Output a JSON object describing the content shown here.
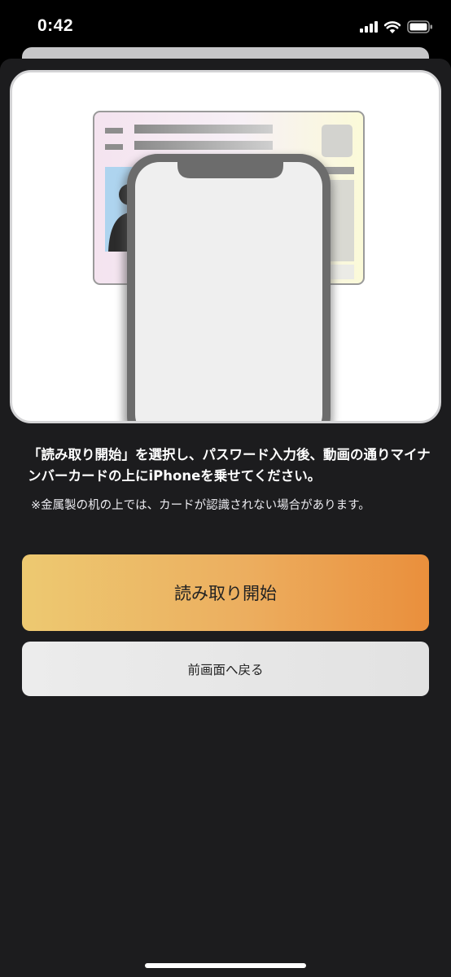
{
  "status_bar": {
    "time": "0:42",
    "icons": [
      "signal-icon",
      "wifi-icon",
      "battery-icon"
    ]
  },
  "instruction": {
    "main_text": "「読み取り開始」を選択し、パスワード入力後、動画の通りマイナンバーカードの上にiPhoneを乗せてください。",
    "note_text": "※金属製の机の上では、カードが認識されない場合があります。"
  },
  "buttons": {
    "start_read_label": "読み取り開始",
    "back_label": "前画面へ戻る"
  },
  "colors": {
    "sheet_background": "#1c1c1e",
    "primary_gradient_start": "#edc971",
    "primary_gradient_end": "#ea8f3c",
    "secondary_button": "#e4e4e4"
  }
}
